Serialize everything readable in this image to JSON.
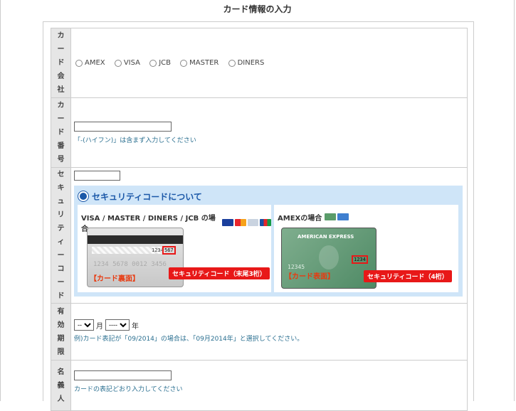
{
  "page": {
    "title": "カード情報の入力"
  },
  "rows": {
    "company": {
      "label": "カード会社",
      "options": [
        "AMEX",
        "VISA",
        "JCB",
        "MASTER",
        "DINERS"
      ]
    },
    "number": {
      "label": "カード番号",
      "note": "「-(ハイフン)」は含まず入力してください"
    },
    "security": {
      "label": "セキュリティーコード",
      "info_title": "セキュリティコードについて",
      "left_title": "VISA / MASTER / DINERS / JCB の場合",
      "left_card_number": "1234 5678 0012 3456",
      "left_sig_digits": "1234",
      "left_sec_digits": "567",
      "left_tag": "【カード裏面】",
      "left_badge": "セキュリティコード（末尾3桁）",
      "right_title": "AMEXの場合",
      "right_card_brand": "AMERICAN EXPRESS",
      "right_card_number": "12345",
      "right_sec_digits": "1234",
      "right_tag": "【カード表面】",
      "right_badge": "セキュリティコード（4桁）"
    },
    "expiry": {
      "label": "有効期限",
      "month_value": "--",
      "month_unit": "月",
      "year_value": "----",
      "year_unit": "年",
      "note": "例)カード表記が「09/2014」の場合は、「09月2014年」と選択してください。"
    },
    "holder": {
      "label": "名義人",
      "note": "カードの表記どおり入力してください"
    }
  },
  "colors": {
    "accent": "#1b58a8",
    "badge": "#e81818",
    "note": "#2a6f90"
  }
}
